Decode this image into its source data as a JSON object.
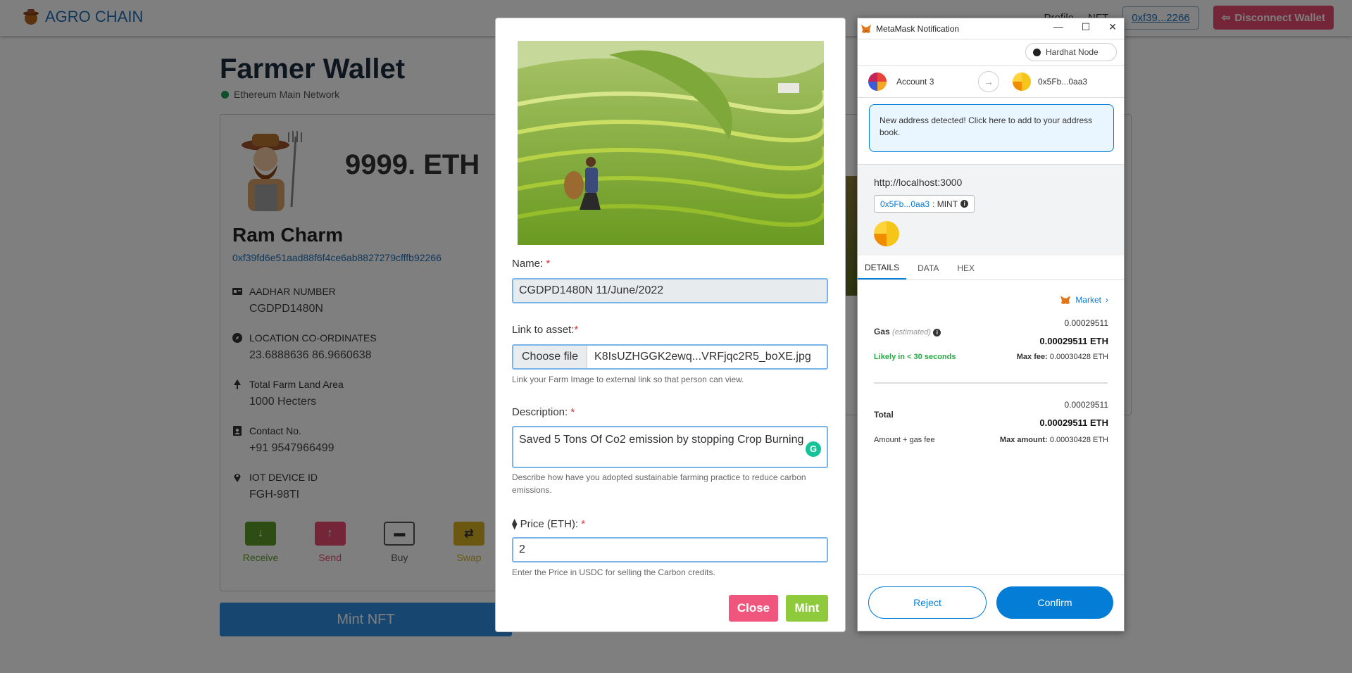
{
  "navbar": {
    "brand": "AGRO CHAIN",
    "profile": "Profile",
    "nft": "NFT",
    "address": "0xf39...2266",
    "disconnect": "Disconnect Wallet"
  },
  "page": {
    "title": "Farmer Wallet",
    "network": "Ethereum Main Network",
    "balance": "9999. ETH",
    "farmer_name": "Ram Charm",
    "farmer_address": "0xf39fd6e51aad88f6f4ce6ab8827279cfffb92266",
    "info": [
      {
        "label": "AADHAR NUMBER",
        "value": "CGDPD1480N",
        "icon": "id-card-icon"
      },
      {
        "label": "LOCATION CO-ORDINATES",
        "value": "23.6888636 86.9660638",
        "icon": "compass-icon"
      },
      {
        "label": "Total Farm Land Area",
        "value": "1000 Hecters",
        "icon": "tree-icon"
      },
      {
        "label": "Contact No.",
        "value": "+91 9547966499",
        "icon": "contact-icon"
      },
      {
        "label": "IOT DEVICE ID",
        "value": "FGH-98TI",
        "icon": "map-pin-icon"
      }
    ],
    "actions": [
      {
        "label": "Receive",
        "color": "#5a9a2a",
        "icon": "arrow-down-icon"
      },
      {
        "label": "Send",
        "color": "#e84a6f",
        "icon": "arrow-up-icon"
      },
      {
        "label": "Buy",
        "color": "#ffffff",
        "icon": "card-icon"
      },
      {
        "label": "Swap",
        "color": "#d4b020",
        "icon": "swap-icon"
      }
    ],
    "mint_button": "Mint NFT"
  },
  "modal": {
    "name_label": "Name:",
    "name_value": "CGDPD1480N 11/June/2022",
    "link_label": "Link to asset:",
    "file_button": "Choose file",
    "file_name": "K8IsUZHGGK2ewq...VRFjqc2R5_boXE.jpg",
    "link_help": "Link your Farm Image to external link so that person can view.",
    "desc_label": "Description:",
    "desc_value": "Saved 5 Tons Of Co2 emission by stopping Crop Burning",
    "desc_help": "Describe how have you adopted sustainable farming practice to reduce carbon emissions.",
    "price_label": "Price (ETH):",
    "price_value": "2",
    "price_help": "Enter the Price in USDC for selling the Carbon credits.",
    "close": "Close",
    "mint": "Mint",
    "required_mark": "*"
  },
  "metamask": {
    "window_title": "MetaMask Notification",
    "network": "Hardhat Node",
    "from_account": "Account 3",
    "to_account": "0x5Fb...0aa3",
    "notice": "New address detected! Click here to add to your address book.",
    "origin": "http://localhost:3000",
    "method_addr": "0x5Fb...0aa3",
    "method": ": MINT",
    "tabs": [
      "DETAILS",
      "DATA",
      "HEX"
    ],
    "market": "Market",
    "gas_label": "Gas",
    "gas_estimated": "(estimated)",
    "gas_small": "0.00029511",
    "gas_bold": "0.00029511 ETH",
    "likely": "Likely in < 30 seconds",
    "max_fee_label": "Max fee:",
    "max_fee_value": "0.00030428 ETH",
    "total_label": "Total",
    "total_small": "0.00029511",
    "total_bold": "0.00029511 ETH",
    "amount_gas_label": "Amount + gas fee",
    "max_amount_label": "Max amount:",
    "max_amount_value": "0.00030428 ETH",
    "reject": "Reject",
    "confirm": "Confirm"
  }
}
